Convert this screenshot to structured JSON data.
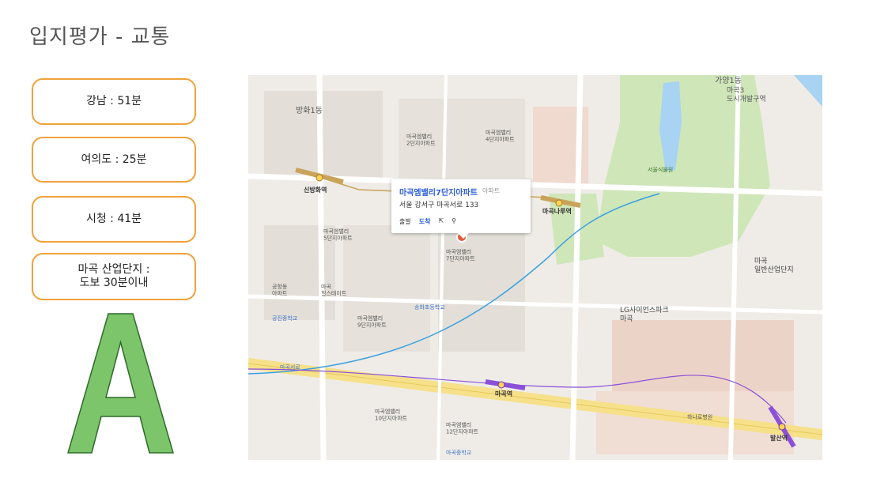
{
  "title": "입지평가 - 교통",
  "cards": [
    {
      "label": "강남 : 51분"
    },
    {
      "label": "여의도 : 25분"
    },
    {
      "label": "시청 : 41분"
    },
    {
      "label": "마곡 산업단지 :\n도보 30분이내"
    }
  ],
  "grade": {
    "letter": "A",
    "fill": "#7cc56b",
    "stroke": "#2f6a29"
  },
  "map": {
    "popup": {
      "name": "마곡엠밸리7단지아파트",
      "type": "아파트",
      "address": "서울 강서구 마곡서로 133",
      "depart": "출발",
      "arrive": "도착"
    },
    "labels": {
      "banghwa1": "방화1동",
      "gayang1": "가양1동",
      "magok3": "마곡3\n도시개발구역",
      "sinbang": "신방화역",
      "magoknaru": "마곡나루역",
      "magok_station": "마곡역",
      "balsan": "발산역",
      "lg_science": "LG사이언스파크\n마곡",
      "industrial": "마곡\n일반산업단지",
      "seoul_botanic": "서울식물원",
      "apt9": "마곡엠밸리\n9단지아파트",
      "apt10": "마곡엠밸리\n10단지아파트",
      "apt12": "마곡엠밸리\n12단지아파트",
      "apt5": "마곡엠밸리\n5단지아파트",
      "apt7": "마곡엠밸리\n7단지아파트",
      "apt2": "마곡엠밸리\n2단지아파트",
      "apt4": "마곡엠밸리\n4단지아파트",
      "hill": "마곡\n힐스테이트",
      "sjt": "공항동\n아파트",
      "gongjin": "공진중학교",
      "magok_mid": "마곡중학교",
      "songhwa": "송화초등학교",
      "hanaro": "하나로병원",
      "magok_ceo": "마곡서로"
    },
    "colors": {
      "line5": "#8b50d8",
      "line9": "#c9a35a",
      "airport": "#3aa0e0",
      "road_major": "#f6e08a",
      "park": "#cfe6b9",
      "water": "#a8d3f2",
      "block": "#e3dfd8"
    }
  }
}
